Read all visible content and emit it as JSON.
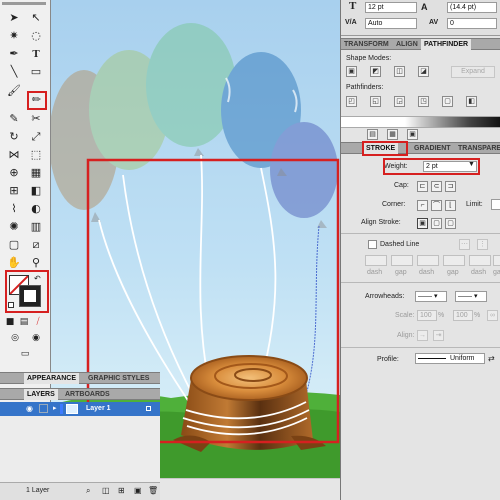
{
  "control_bar": {
    "font_size": "12 pt",
    "leading": "(14.4 pt)",
    "kerning": "Auto",
    "tracking": "0",
    "font_size_icon": "T",
    "kerning_icon": "V/A",
    "tracking_icon": "AV"
  },
  "transform_dock": {
    "tabs": [
      "TRANSFORM",
      "ALIGN",
      "PATHFINDER"
    ],
    "active_tab": "PATHFINDER"
  },
  "pathfinder": {
    "shape_modes_label": "Shape Modes:",
    "expand_label": "Expand",
    "pathfinders_label": "Pathfinders:"
  },
  "stroke_dock": {
    "tabs": [
      "STROKE",
      "GRADIENT",
      "TRANSPARENCY"
    ],
    "active_tab": "STROKE"
  },
  "stroke": {
    "weight_label": "Weight:",
    "weight_value": "2 pt",
    "cap_label": "Cap:",
    "corner_label": "Corner:",
    "limit_label": "Limit:",
    "align_stroke_label": "Align Stroke:",
    "dashed_line_label": "Dashed Line",
    "dash_labels": [
      "dash",
      "gap",
      "dash",
      "gap",
      "dash",
      "gap"
    ],
    "arrowheads_label": "Arrowheads:",
    "scale_label": "Scale:",
    "scale_start": "100",
    "scale_end": "100",
    "percent": "%",
    "align_label": "Align:",
    "profile_label": "Profile:",
    "profile_value": "Uniform"
  },
  "appearance_dock": {
    "tabs": [
      "APPEARANCE",
      "GRAPHIC STYLES"
    ],
    "active_tab": "APPEARANCE"
  },
  "layers_dock": {
    "tabs": [
      "LAYERS",
      "ARTBOARDS"
    ],
    "active_tab": "LAYERS"
  },
  "layers": {
    "items": [
      {
        "name": "Layer 1",
        "color": "#3d7bff"
      }
    ],
    "footer_count": "1 Layer"
  },
  "tools": {
    "selection": "selection-icon",
    "direct_selection": "direct-selection-icon",
    "paintbrush": "paintbrush-icon",
    "pencil": "pencil-icon",
    "fill_stroke": "fill-stroke-icon"
  },
  "colors": {
    "highlight": "#d62020",
    "layer_color": "#3d7bff",
    "selected_layer_bg": "#3574c9"
  }
}
